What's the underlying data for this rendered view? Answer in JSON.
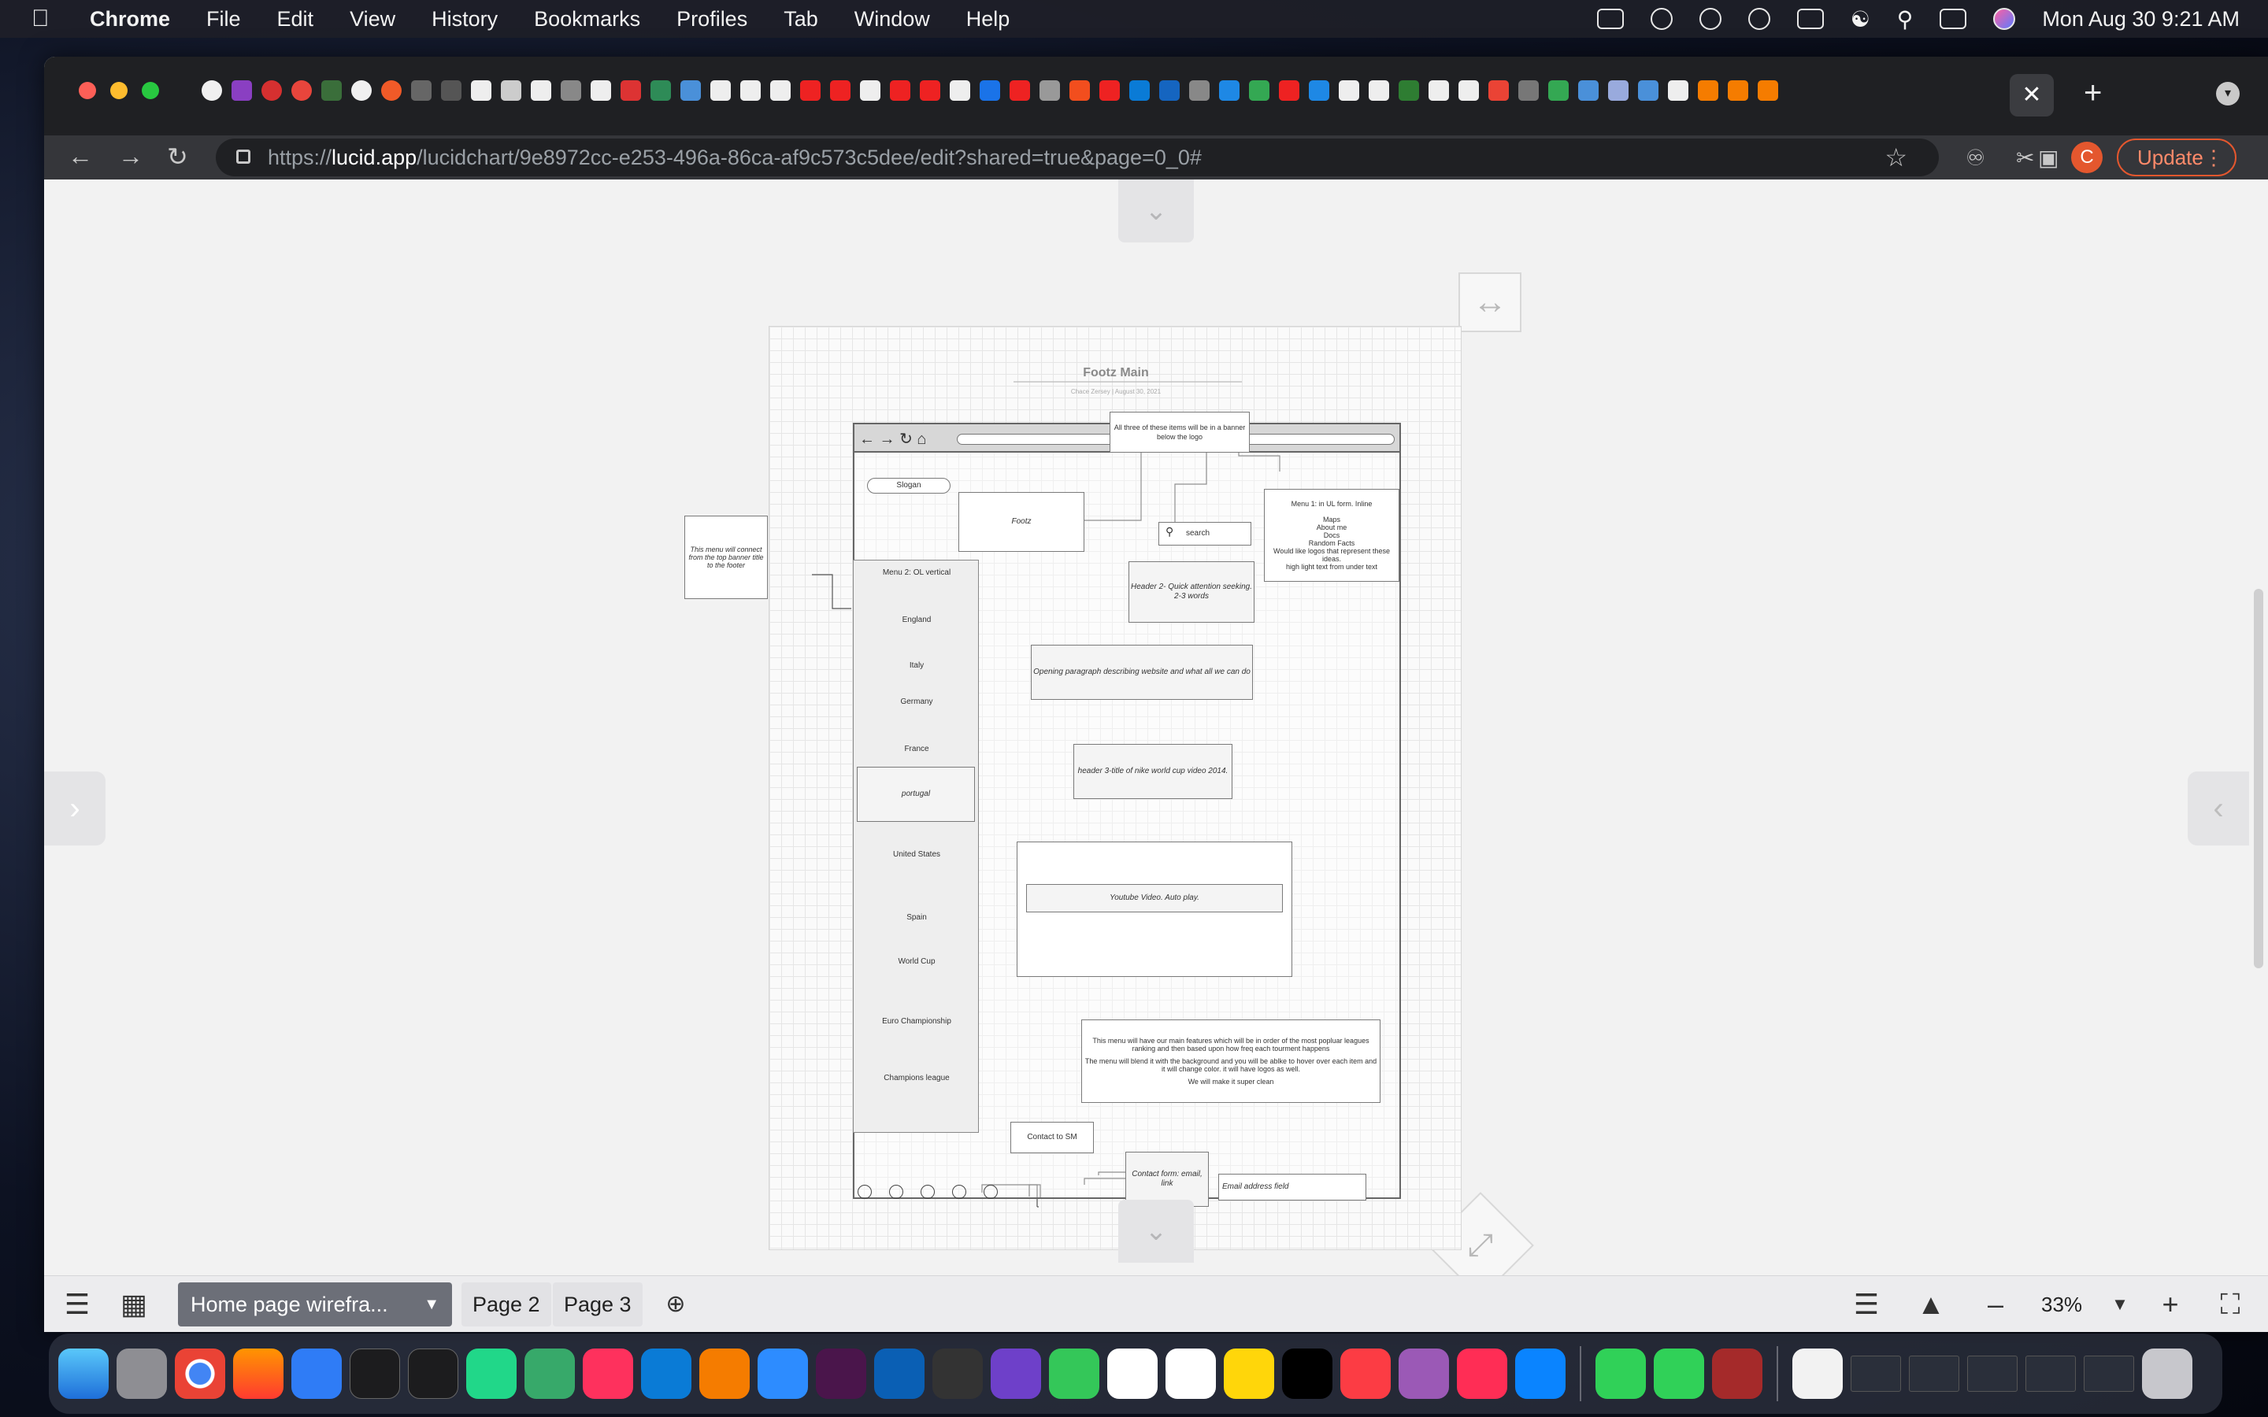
{
  "menubar": {
    "app_name": "Chrome",
    "items": [
      "File",
      "Edit",
      "View",
      "History",
      "Bookmarks",
      "Profiles",
      "Tab",
      "Window",
      "Help"
    ],
    "clock": "Mon Aug 30  9:21 AM"
  },
  "browser": {
    "url_scheme": "https://",
    "url_host": "lucid.app",
    "url_path": "/lucidchart/9e8972cc-e253-496a-86ca-af9c573c5dee/edit?shared=true&page=0_0#",
    "update_label": "Update",
    "profile_initial": "C"
  },
  "wireframe": {
    "title": "Footz Main",
    "subtitle": "Chace Zersey  |  August 30, 2021",
    "banner_note": "All three of these items will be in a banner below the logo",
    "slogan": "Slogan",
    "logo": "Footz",
    "search_placeholder": "search",
    "menu1": "Menu 1: in UL form. Inline\n\nMaps\nAbout me\nDocs\nRandom Facts\nWould like logos that represent these ideas.\nhigh light text from under text",
    "side_note": "This menu will connect from the top banner title to the footer",
    "menu2_title": "Menu 2: OL vertical",
    "menu2_items": [
      "England",
      "Italy",
      "Germany",
      "France",
      "portugal",
      "United States",
      "Spain",
      "World Cup",
      "Euro Championship",
      "Champions league"
    ],
    "header2": "Header 2- Quick attention seeking. 2-3 words",
    "opening_paragraph": "Opening paragraph describing website and what all we can do",
    "header3": "header 3-title of nike world cup video 2014.",
    "youtube": "Youtube Video. Auto play.",
    "menu_note_1": "This menu will have our main features which will be in order of the most popluar leagues ranking and then based upon how freq each tourment happens",
    "menu_note_2": "The menu will blend it with the background and you will be  ablke to hover over each item and it will change color. it will have logos as well.",
    "menu_note_3": "We will make it super clean",
    "contact_sm": "Contact to SM",
    "contact_form": "Contact form: email, link",
    "email_field": "Email address field"
  },
  "bottombar": {
    "active_page": "Home page wirefra...",
    "pages": [
      "Page 2",
      "Page 3"
    ],
    "zoom": "33%"
  },
  "colors": {
    "accent_update": "#e4572e",
    "tab_active_bg": "#6c6f78"
  }
}
